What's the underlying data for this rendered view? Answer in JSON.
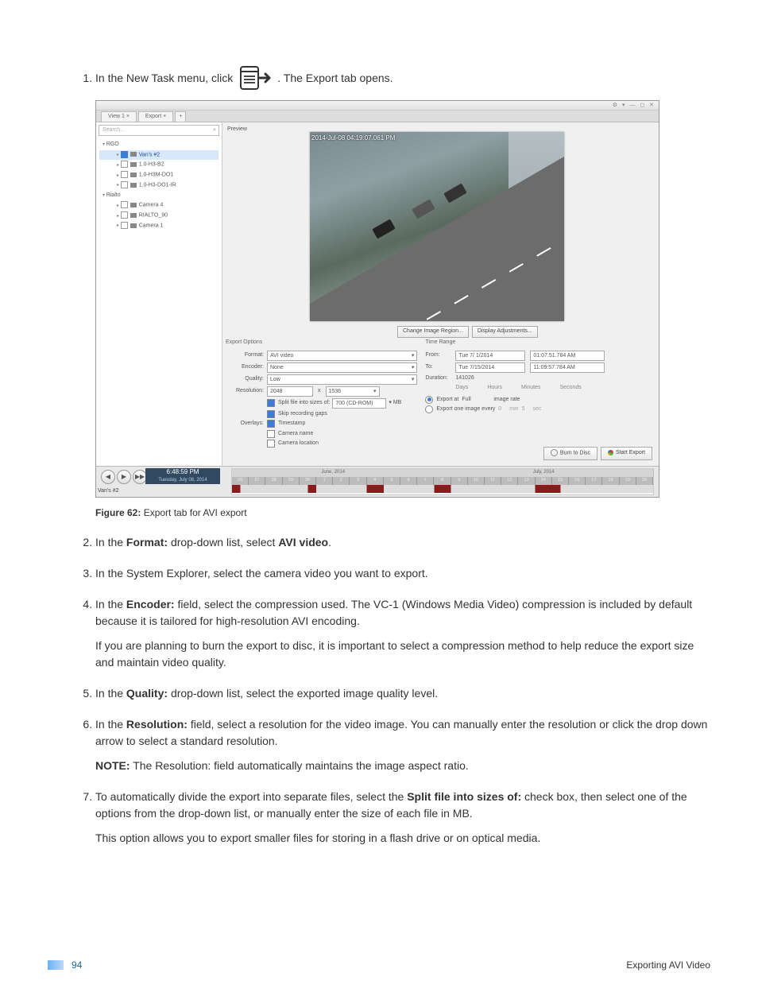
{
  "step1": {
    "pre": "In the New Task menu, click",
    "post": ". The Export tab opens."
  },
  "figure": {
    "label": "Figure 62:",
    "caption": "Export tab for AVI export"
  },
  "step2": {
    "pre": "In the",
    "bold": "Format:",
    "post": "drop-down list, select",
    "bold2": "AVI video",
    "post2": "."
  },
  "step3": "In the System Explorer, select the camera video you want to export.",
  "step4": {
    "pre": "In the",
    "bold": "Encoder:",
    "post": "field, select the compression used. The VC-1 (Windows Media Video) compression is included by default because it is tailored for high-resolution AVI encoding.",
    "para2": "If you are planning to burn the export to disc, it is important to select a compression method to help reduce the export size and maintain video quality."
  },
  "step5": {
    "pre": "In the",
    "bold": "Quality:",
    "post": "drop-down list, select the exported image quality level."
  },
  "step6": {
    "pre": "In the",
    "bold": "Resolution:",
    "post": "field, select a resolution for the video image. You can manually enter the resolution or click the drop down arrow to select a standard resolution.",
    "notebold": "NOTE:",
    "note": "The Resolution: field automatically maintains the image aspect ratio."
  },
  "step7": {
    "pre": "To automatically divide the export into separate files, select the",
    "bold": "Split file into sizes of:",
    "post": "check box, then select one of the options from the drop-down list, or manually enter the size of each file in MB.",
    "para2": "This option allows you to export smaller files for storing in a flash drive or on optical media."
  },
  "footer": {
    "page": "94",
    "title": "Exporting AVI Video"
  },
  "screenshot": {
    "window_icons": "⚙ ▾   —   ◻   ✕",
    "tabs": {
      "view": "View 1 ×",
      "export": "Export ×",
      "plus": "+"
    },
    "sidebar": {
      "search_placeholder": "Search...",
      "nodes": {
        "root1": "RGO",
        "c1": "Van's #2",
        "c2": "1.0-H3-B2",
        "c3": "1.0-H3M-DO1",
        "c4": "1.0-H3-DO1-IR",
        "root2": "Rialto",
        "c5": "Camera 4",
        "c6": "RIALTO_90",
        "c7": "Camera 1"
      }
    },
    "preview": {
      "label": "Preview",
      "overlay": "2014-Jul-08 04:19:07.061 PM",
      "btn_region": "Change Image Region...",
      "btn_adjust": "Display Adjustments..."
    },
    "export_options": {
      "title": "Export Options",
      "format_lbl": "Format:",
      "format_val": "AVI video",
      "encoder_lbl": "Encoder:",
      "encoder_val": "None",
      "quality_lbl": "Quality:",
      "quality_val": "Low",
      "resolution_lbl": "Resolution:",
      "resolution_w": "2048",
      "resolution_x": "x",
      "resolution_h": "1536",
      "split_lbl": "Split file into sizes of:",
      "split_val": "700 (CD-ROM)",
      "split_unit": "▾ MB",
      "skiprec": "Skip recording gaps",
      "overlays_lbl": "Overlays:",
      "overlay_ts": "Timestamp",
      "overlay_cn": "Camera name",
      "overlay_cl": "Camera location"
    },
    "time_range": {
      "title": "Time Range",
      "from_lbl": "From:",
      "from_date": "Tue   7/ 1/2014",
      "from_time": "01:07:51.784  AM",
      "to_lbl": "To:",
      "to_date": "Tue   7/15/2014",
      "to_time": "11:09:57.784  AM",
      "dur_lbl": "Duration:",
      "dur_d": "14",
      "dur_h": "10",
      "dur_m": "2",
      "dur_s": "6",
      "unit_d": "Days",
      "unit_h": "Hours",
      "unit_m": "Minutes",
      "unit_s": "Seconds",
      "export_at_lbl": "Export at",
      "export_at_val": "Full",
      "export_at_post": "image rate",
      "export_one_lbl": "Export one image every",
      "export_one_v1": "0",
      "export_one_u1": "min",
      "export_one_v2": "5",
      "export_one_u2": "sec"
    },
    "bottom": {
      "burn": "Burn to Disc",
      "start": "Start Export"
    },
    "timeline": {
      "time": "6:48:59 PM",
      "sub": "Tuesday, July 08, 2014",
      "camera": "Van's #2",
      "month1": "June, 2014",
      "month2": "July, 2014",
      "days": [
        "26",
        "27",
        "28",
        "29",
        "30",
        "1",
        "2",
        "3",
        "4",
        "5",
        "6",
        "7",
        "8",
        "9",
        "10",
        "11",
        "12",
        "13",
        "14",
        "15",
        "16",
        "17",
        "18",
        "19",
        "20"
      ]
    }
  }
}
